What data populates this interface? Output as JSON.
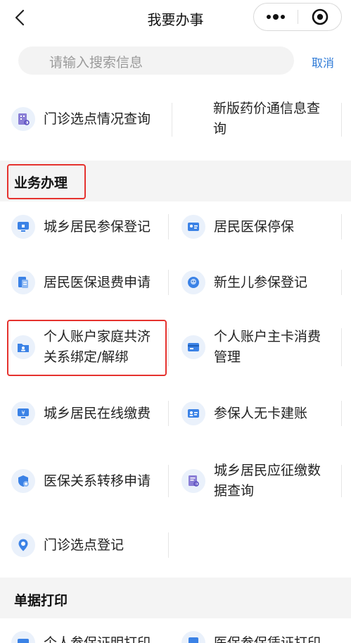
{
  "navbar": {
    "title": "我要办事"
  },
  "search": {
    "placeholder": "请输入搜索信息",
    "cancel_label": "取消"
  },
  "top_items": [
    {
      "label": "门诊选点情况查询",
      "icon": "hospital-search-icon"
    },
    {
      "label": "新版药价通信息查询",
      "icon": ""
    }
  ],
  "sections": [
    {
      "title": "业务办理",
      "items": [
        {
          "label": "城乡居民参保登记",
          "icon": "monitor-icon"
        },
        {
          "label": "居民医保停保",
          "icon": "id-card-icon"
        },
        {
          "label": "居民医保退费申请",
          "icon": "document-icon"
        },
        {
          "label": "新生儿参保登记",
          "icon": "baby-icon"
        },
        {
          "label": "个人账户家庭共济关系绑定/解绑",
          "icon": "family-folder-icon"
        },
        {
          "label": "个人账户主卡消费管理",
          "icon": "card-icon"
        },
        {
          "label": "城乡居民在线缴费",
          "icon": "payment-icon"
        },
        {
          "label": "参保人无卡建账",
          "icon": "account-card-icon"
        },
        {
          "label": "医保关系转移申请",
          "icon": "transfer-shield-icon"
        },
        {
          "label": "城乡居民应征缴数据查询",
          "icon": "data-search-icon"
        },
        {
          "label": "门诊选点登记",
          "icon": "location-pin-icon"
        }
      ]
    },
    {
      "title": "单据打印",
      "items": [
        {
          "label": "个人参保证明打印",
          "icon": "print-icon"
        },
        {
          "label": "医保参保凭证打印",
          "icon": "certificate-icon"
        }
      ]
    }
  ],
  "colors": {
    "accent": "#2f7bd7",
    "highlight_border": "#e5322e",
    "section_bg": "#f4f4f4",
    "icon_bg": "#eaf1fb",
    "icon_fg": "#3b82e6"
  }
}
